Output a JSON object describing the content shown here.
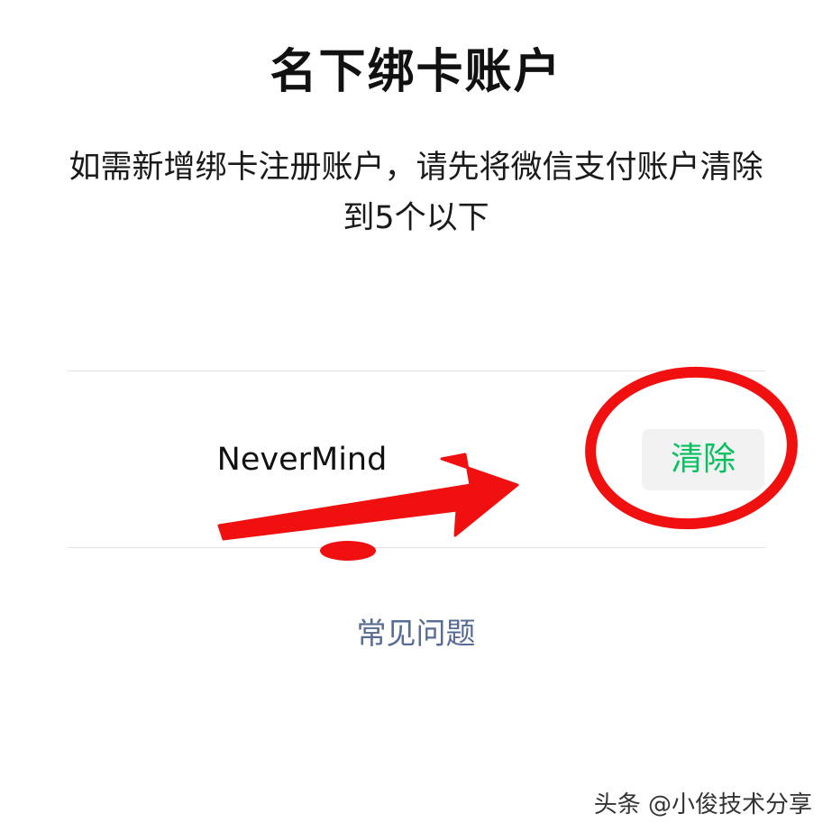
{
  "header": {
    "title": "名下绑卡账户"
  },
  "notice": {
    "text": "如需新增绑卡注册账户，请先将微信支付账户清除到5个以下"
  },
  "account": {
    "name": "NeverMind",
    "clear_label": "清除"
  },
  "footer": {
    "faq_label": "常见问题"
  },
  "watermark": {
    "text": "头条 @小俊技术分享"
  },
  "colors": {
    "accent_green": "#07c160",
    "link_blue": "#576b95",
    "annotation_red": "#f01010"
  }
}
